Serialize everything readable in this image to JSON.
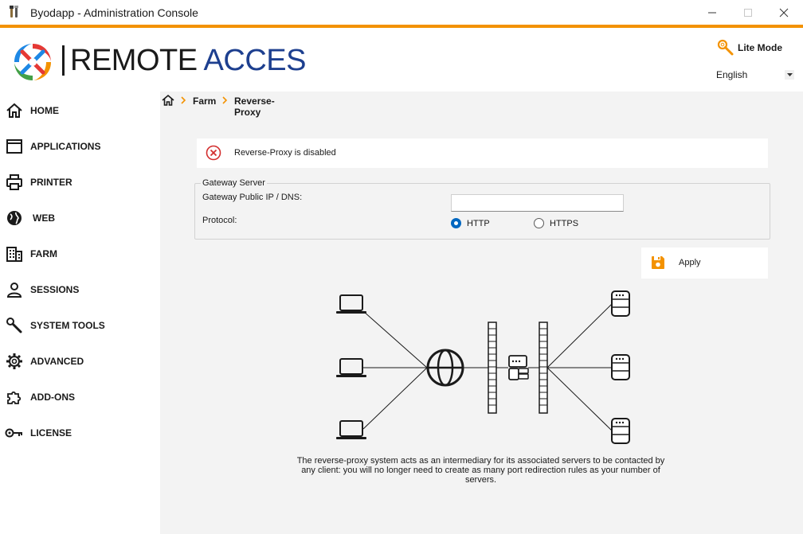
{
  "window": {
    "title": "Byodapp - Administration Console"
  },
  "header": {
    "logo_text_left": "REMOTE",
    "logo_text_right": "ACCES",
    "lite_mode_label": "Lite Mode",
    "language": "English"
  },
  "sidebar": {
    "items": [
      {
        "label": "HOME",
        "icon": "home-icon"
      },
      {
        "label": "APPLICATIONS",
        "icon": "window-icon"
      },
      {
        "label": "PRINTER",
        "icon": "printer-icon"
      },
      {
        "label": "WEB",
        "icon": "globe-icon"
      },
      {
        "label": "FARM",
        "icon": "building-icon"
      },
      {
        "label": "SESSIONS",
        "icon": "user-icon"
      },
      {
        "label": "SYSTEM TOOLS",
        "icon": "wrench-icon"
      },
      {
        "label": "ADVANCED",
        "icon": "gear-icon"
      },
      {
        "label": "ADD-ONS",
        "icon": "puzzle-icon"
      },
      {
        "label": "LICENSE",
        "icon": "key-icon"
      }
    ]
  },
  "breadcrumb": {
    "items": [
      "Farm",
      "Reverse-Proxy"
    ]
  },
  "alert": {
    "text": "Reverse-Proxy is disabled"
  },
  "gateway": {
    "group_title": "Gateway Server",
    "ip_label": "Gateway Public IP / DNS:",
    "ip_value": "",
    "protocol_label": "Protocol:",
    "protocol_options": [
      "HTTP",
      "HTTPS"
    ],
    "protocol_selected": "HTTP"
  },
  "apply": {
    "label": "Apply"
  },
  "description": "The reverse-proxy system acts as an intermediary for its associated servers to be contacted by any client: you will no longer need to create as many port redirection rules as your number of servers.",
  "colors": {
    "accent": "#f39200",
    "brand_blue": "#1d3f8f",
    "error": "#d32f2f",
    "radio_selected": "#0067c0"
  }
}
